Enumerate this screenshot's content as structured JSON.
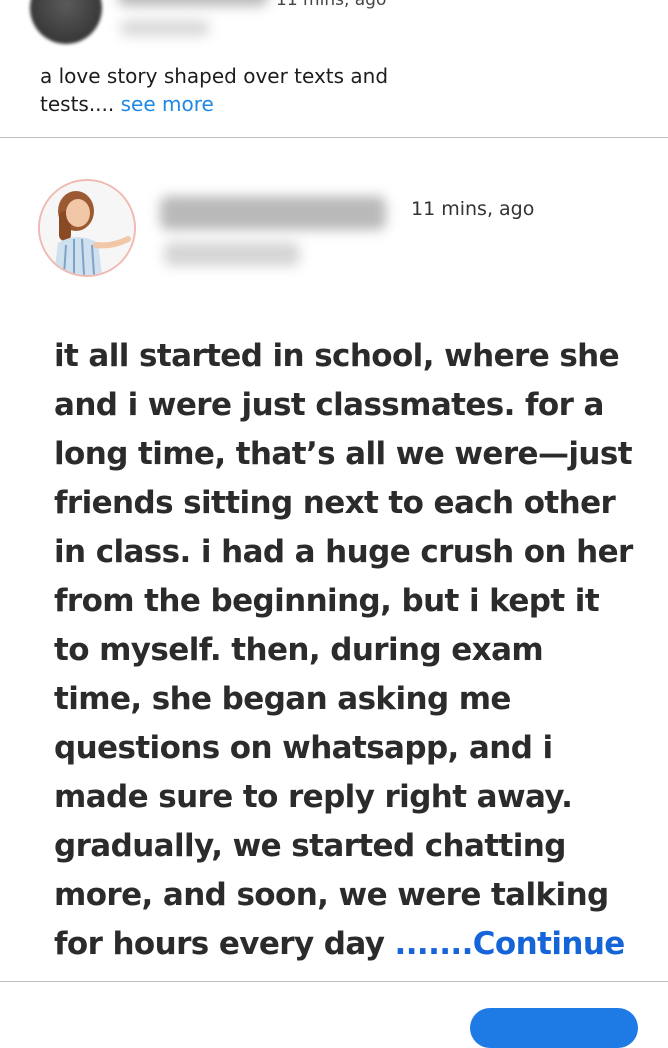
{
  "top_post": {
    "time": "11 mins, ago",
    "snippet": "a love story shaped over texts and tests....",
    "see_more": "see more"
  },
  "main_post": {
    "time": "11 mins, ago",
    "story": "it all started in school, where she and i were just classmates. for a long time, that’s all we were—just friends sitting next to each other in class. i had a huge crush on her from the beginning, but i kept it to myself. then, during exam time, she began asking me questions on whatsapp, and i made sure to reply right away. gradually, we started chatting more, and soon, we were talking for hours every day",
    "continue_label": ".......Continue"
  },
  "colors": {
    "link": "#1e88e5",
    "continue_link": "#1565d8",
    "divider": "#bdbdbd",
    "avatar_ring": "#f0b9b2"
  },
  "icons": {
    "top_avatar": "avatar",
    "main_avatar": "avatar"
  }
}
